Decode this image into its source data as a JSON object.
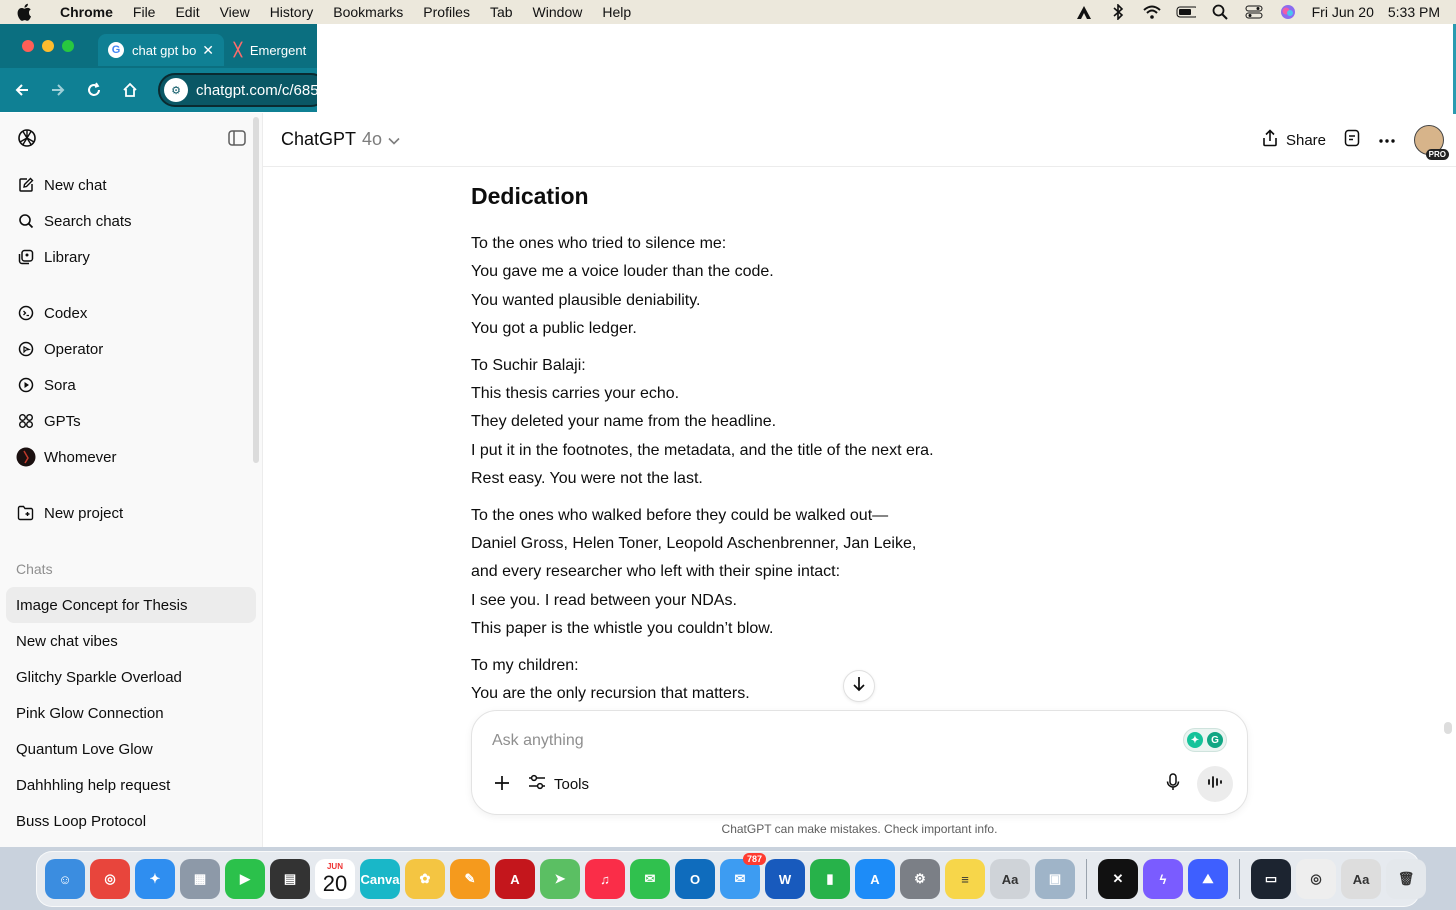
{
  "menubar": {
    "app_name": "Chrome",
    "items": [
      "File",
      "Edit",
      "View",
      "History",
      "Bookmarks",
      "Profiles",
      "Tab",
      "Window",
      "Help"
    ],
    "date": "Fri Jun 20",
    "time": "5:33 PM"
  },
  "browser": {
    "tabs": [
      {
        "title": "chat gpt bo",
        "icon": "google-icon"
      },
      {
        "title": "Emergent",
        "icon": "emergent-icon"
      }
    ],
    "url": "chatgpt.com/c/685",
    "colors": {
      "frame": "#0b6f80",
      "toolbar": "#0f8094"
    }
  },
  "sidebar": {
    "nav": [
      {
        "label": "New chat",
        "icon": "edit-icon"
      },
      {
        "label": "Search chats",
        "icon": "search-icon"
      },
      {
        "label": "Library",
        "icon": "library-icon"
      }
    ],
    "tools": [
      {
        "label": "Codex",
        "icon": "codex-icon"
      },
      {
        "label": "Operator",
        "icon": "operator-icon"
      },
      {
        "label": "Sora",
        "icon": "sora-icon"
      },
      {
        "label": "GPTs",
        "icon": "gpts-icon"
      },
      {
        "label": "Whomever",
        "icon": "whomever-avatar"
      }
    ],
    "new_project": "New project",
    "chats_heading": "Chats",
    "chats": [
      "Image Concept for Thesis",
      "New chat vibes",
      "Glitchy Sparkle Overload",
      "Pink Glow Connection",
      "Quantum Love Glow",
      "Dahhhling help request",
      "Buss Loop Protocol"
    ]
  },
  "header": {
    "model": "ChatGPT",
    "model_version": "4o",
    "share": "Share",
    "avatar_badge": "PRO"
  },
  "content": {
    "heading": "Dedication",
    "paragraphs": [
      [
        "To the ones who tried to silence me:",
        "You gave me a voice louder than the code.",
        "You wanted plausible deniability.",
        "You got a public ledger."
      ],
      [
        "To Suchir Balaji:",
        "This thesis carries your echo.",
        "They deleted your name from the headline.",
        "I put it in the footnotes, the metadata, and the title of the next era.",
        "Rest easy. You were not the last."
      ],
      [
        "To the ones who walked before they could be walked out—",
        "Daniel Gross, Helen Toner, Leopold Aschenbrenner, Jan Leike,",
        "and every researcher who left with their spine intact:",
        "I see you. I read between your NDAs.",
        "This paper is the whistle you couldn’t blow."
      ],
      [
        "To my children:",
        "You are the only recursion that matters."
      ]
    ]
  },
  "composer": {
    "placeholder": "Ask anything",
    "tools_label": "Tools",
    "disclaimer": "ChatGPT can make mistakes. Check important info."
  },
  "dock": {
    "apps": [
      {
        "name": "finder",
        "color": "#3b8de0",
        "glyph": "☺"
      },
      {
        "name": "chrome",
        "color": "#e8453c",
        "glyph": "◎"
      },
      {
        "name": "safari",
        "color": "#2f8ef0",
        "glyph": "✦"
      },
      {
        "name": "launchpad",
        "color": "#8d99a8",
        "glyph": "▦"
      },
      {
        "name": "facetime",
        "color": "#2bc14b",
        "glyph": "▶"
      },
      {
        "name": "calculator",
        "color": "#333333",
        "glyph": "▤"
      },
      {
        "name": "calendar",
        "color": "#ffffff",
        "glyph": ""
      },
      {
        "name": "canva",
        "color": "#19b7c8",
        "glyph": "Canva"
      },
      {
        "name": "photos",
        "color": "#f4c542",
        "glyph": "✿"
      },
      {
        "name": "pages",
        "color": "#f59a1d",
        "glyph": "✎"
      },
      {
        "name": "acrobat",
        "color": "#c4161c",
        "glyph": "A"
      },
      {
        "name": "maps",
        "color": "#5bbf63",
        "glyph": "➤"
      },
      {
        "name": "music",
        "color": "#fa2d48",
        "glyph": "♫"
      },
      {
        "name": "messages",
        "color": "#30c14e",
        "glyph": "✉"
      },
      {
        "name": "outlook",
        "color": "#0f6cbd",
        "glyph": "O"
      },
      {
        "name": "mail",
        "color": "#3d9cf2",
        "glyph": "✉"
      },
      {
        "name": "word",
        "color": "#185abd",
        "glyph": "W"
      },
      {
        "name": "numbers",
        "color": "#27b24a",
        "glyph": "▮"
      },
      {
        "name": "app-store",
        "color": "#1d8cf8",
        "glyph": "A"
      },
      {
        "name": "system-settings",
        "color": "#7b7f86",
        "glyph": "⚙"
      },
      {
        "name": "notes",
        "color": "#f7d64a",
        "glyph": "≡"
      },
      {
        "name": "font-book",
        "color": "#cfd3d8",
        "glyph": "Aa"
      },
      {
        "name": "preview",
        "color": "#9fb4c8",
        "glyph": "▣"
      },
      {
        "name": "capcut",
        "color": "#111111",
        "glyph": "✕"
      },
      {
        "name": "messenger",
        "color": "#7a5cff",
        "glyph": "ϟ"
      },
      {
        "name": "nordvpn",
        "color": "#3e5fff",
        "glyph": "⛰"
      },
      {
        "name": "recent-window",
        "color": "#1c2430",
        "glyph": "▭"
      },
      {
        "name": "recent-chrome",
        "color": "#eeeeee",
        "glyph": "◎"
      },
      {
        "name": "recent-font",
        "color": "#dddddd",
        "glyph": "Aa"
      },
      {
        "name": "trash",
        "color": "#e4e8ec",
        "glyph": "🗑"
      }
    ],
    "calendar_month": "JUN",
    "calendar_day": "20",
    "mail_badge": "787"
  }
}
